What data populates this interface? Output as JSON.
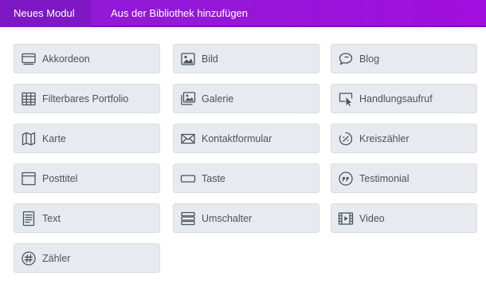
{
  "tabs": {
    "new_module": "Neues Modul",
    "from_library": "Aus der Bibliothek hinzufügen"
  },
  "modules": [
    {
      "label": "Akkordeon",
      "icon": "accordion-icon"
    },
    {
      "label": "Bild",
      "icon": "image-icon"
    },
    {
      "label": "Blog",
      "icon": "blog-icon"
    },
    {
      "label": "Filterbares Portfolio",
      "icon": "portfolio-grid-icon"
    },
    {
      "label": "Galerie",
      "icon": "gallery-icon"
    },
    {
      "label": "Handlungsaufruf",
      "icon": "call-to-action-icon"
    },
    {
      "label": "Karte",
      "icon": "map-icon"
    },
    {
      "label": "Kontaktformular",
      "icon": "envelope-icon"
    },
    {
      "label": "Kreiszähler",
      "icon": "circle-counter-icon"
    },
    {
      "label": "Posttitel",
      "icon": "post-title-icon"
    },
    {
      "label": "Taste",
      "icon": "button-icon"
    },
    {
      "label": "Testimonial",
      "icon": "quote-icon"
    },
    {
      "label": "Text",
      "icon": "text-document-icon"
    },
    {
      "label": "Umschalter",
      "icon": "toggle-icon"
    },
    {
      "label": "Video",
      "icon": "video-icon"
    },
    {
      "label": "Zähler",
      "icon": "hash-counter-icon"
    }
  ],
  "colors": {
    "tab_bar": "#9617d8",
    "tab_active": "#7d18c4",
    "tile_background": "#e7ebef",
    "text": "#4a5360"
  }
}
